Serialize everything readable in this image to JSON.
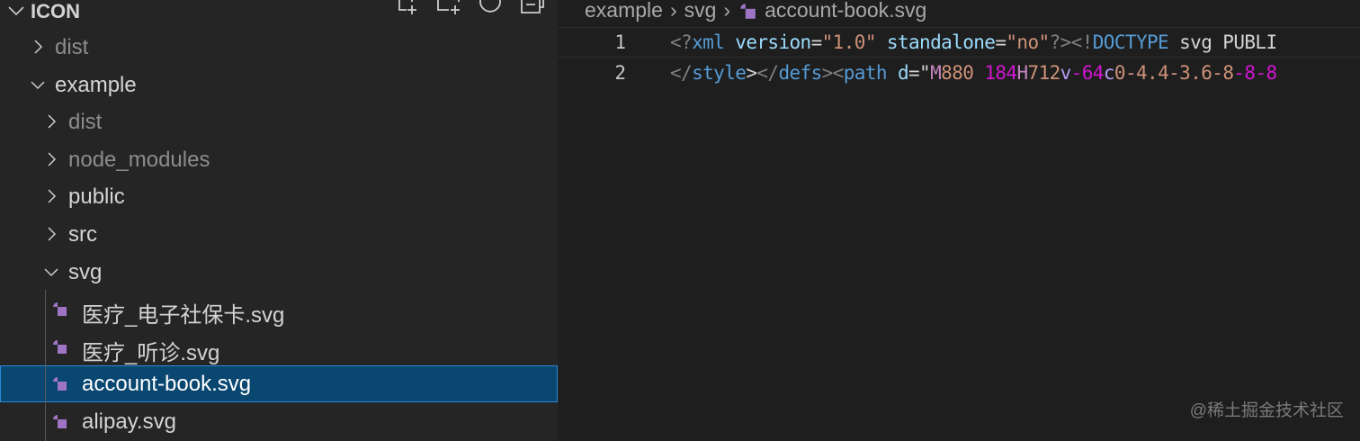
{
  "explorer": {
    "title": "ICON",
    "actions": [
      "new-file",
      "new-folder",
      "refresh",
      "collapse-all"
    ],
    "rows": [
      {
        "label": "dist",
        "type": "folder",
        "expanded": false,
        "level": 0,
        "dim": true
      },
      {
        "label": "example",
        "type": "folder",
        "expanded": true,
        "level": 0,
        "dim": false
      },
      {
        "label": "dist",
        "type": "folder",
        "expanded": false,
        "level": 1,
        "dim": true
      },
      {
        "label": "node_modules",
        "type": "folder",
        "expanded": false,
        "level": 1,
        "dim": true
      },
      {
        "label": "public",
        "type": "folder",
        "expanded": false,
        "level": 1,
        "dim": false
      },
      {
        "label": "src",
        "type": "folder",
        "expanded": false,
        "level": 1,
        "dim": false
      },
      {
        "label": "svg",
        "type": "folder",
        "expanded": true,
        "level": 1,
        "dim": false
      },
      {
        "label": "医疗_电子社保卡.svg",
        "type": "file",
        "level": 2,
        "dim": false
      },
      {
        "label": "医疗_听诊.svg",
        "type": "file",
        "level": 2,
        "dim": false
      },
      {
        "label": "account-book.svg",
        "type": "file",
        "level": 2,
        "dim": false,
        "selected": true
      },
      {
        "label": "alipay.svg",
        "type": "file",
        "level": 2,
        "dim": false
      }
    ]
  },
  "editor": {
    "breadcrumbs": [
      "example",
      "svg",
      "account-book.svg"
    ],
    "lines": [
      {
        "number": "1",
        "tokens": [
          [
            "<?",
            "#808080"
          ],
          [
            "xml",
            "#569cd6"
          ],
          [
            " version",
            "#9cdcfe"
          ],
          [
            "=",
            "#d4d4d4"
          ],
          [
            "\"1.0\"",
            "#ce9178"
          ],
          [
            " standalone",
            "#9cdcfe"
          ],
          [
            "=",
            "#d4d4d4"
          ],
          [
            "\"no\"",
            "#ce9178"
          ],
          [
            "?><!",
            "#808080"
          ],
          [
            "DOCTYPE",
            "#569cd6"
          ],
          [
            " svg PUBLI",
            "#d4d4d4"
          ]
        ]
      },
      {
        "number": "2",
        "tokens": [
          [
            "</",
            "#808080"
          ],
          [
            "style",
            "#569cd6"
          ],
          [
            ">",
            "#d4d4d4"
          ],
          [
            "</",
            "#808080"
          ],
          [
            "defs",
            "#569cd6"
          ],
          [
            "><",
            "#808080"
          ],
          [
            "path",
            "#569cd6"
          ],
          [
            " d",
            "#9cdcfe"
          ],
          [
            "=\"",
            "#d4d4d4"
          ],
          [
            "M",
            "#c586c0"
          ],
          [
            "880",
            "#ce9178"
          ],
          [
            " 184",
            "#d016d0"
          ],
          [
            "H",
            "#c586c0"
          ],
          [
            "712",
            "#ce9178"
          ],
          [
            "v",
            "#b59cf5"
          ],
          [
            "-64",
            "#d016d0"
          ],
          [
            "c",
            "#b59cf5"
          ],
          [
            "0-4.4-3.6-8",
            "#ce9178"
          ],
          [
            "-8-8",
            "#d016d0"
          ]
        ]
      }
    ]
  },
  "watermark": "@稀土掘金技术社区",
  "colors": {
    "sidebar": "#252526",
    "editor": "#1e1e1e",
    "selection": "#094771",
    "svg_icon": "#a074c4"
  }
}
